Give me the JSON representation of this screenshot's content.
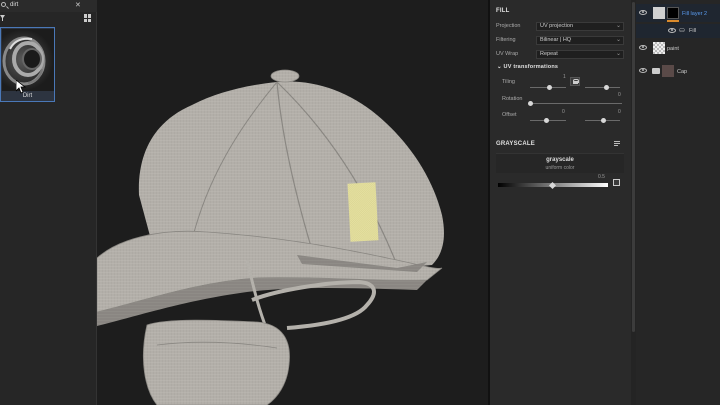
{
  "asset_panel": {
    "search_value": "dirt",
    "search_clear": "✕",
    "asset": {
      "label": "Dirt"
    }
  },
  "properties": {
    "fill_title": "FILL",
    "projection": {
      "label": "Projection",
      "value": "UV projection"
    },
    "filtering": {
      "label": "Filtering",
      "value": "Bilinear | HQ"
    },
    "uv_wrap": {
      "label": "UV Wrap",
      "value": "Repeat"
    },
    "uv_transformations": {
      "title": "UV transformations",
      "tiling": {
        "label": "Tiling",
        "value": "1"
      },
      "rotation": {
        "label": "Rotation",
        "value": "0"
      },
      "offset": {
        "label": "Offset",
        "value_u": "0",
        "value_v": "0"
      }
    },
    "grayscale_title": "GRAYSCALE",
    "grayscale": {
      "name": "grayscale",
      "subtitle": "uniform color",
      "value": "0.5"
    }
  },
  "layers": [
    {
      "name": "Fill layer 2",
      "selected": true,
      "type": "fill"
    },
    {
      "name": "Fill",
      "type": "effect"
    },
    {
      "name": "paint",
      "type": "paint"
    },
    {
      "name": "Cap",
      "type": "folder"
    }
  ],
  "colors": {
    "accent": "#4a78b8",
    "selected_layer_text": "#5a9cf0",
    "panel_bg": "#2a2a2a",
    "viewport_bg": "#1d1d1d",
    "model_gray": "#b9b6b0",
    "patch_yellow": "#e2dd9b"
  }
}
